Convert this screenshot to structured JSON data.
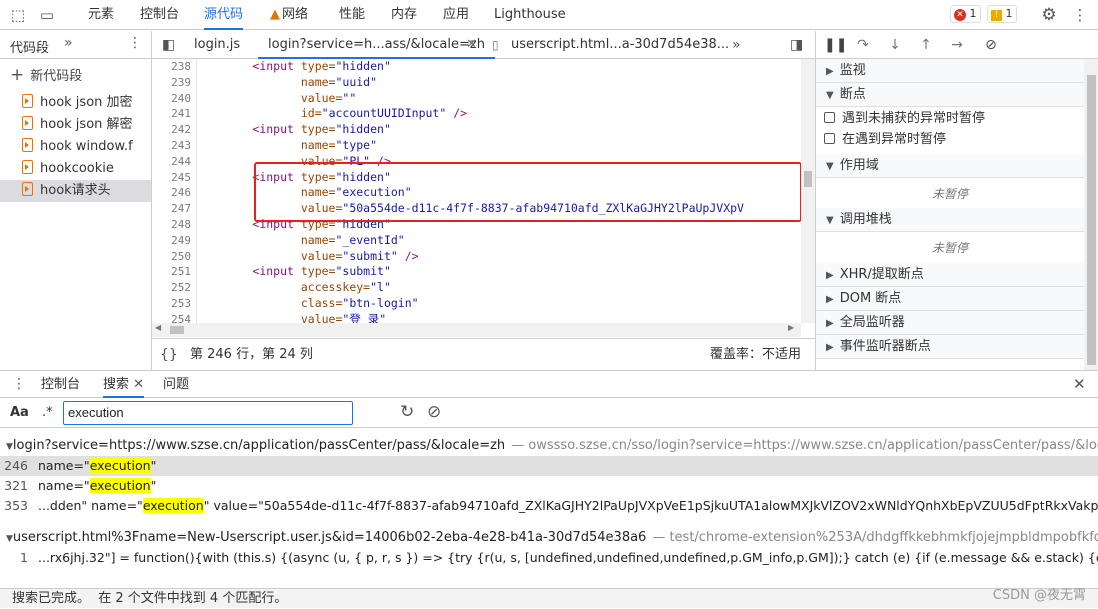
{
  "topbar": {
    "tabs": [
      "元素",
      "控制台",
      "源代码",
      "网络",
      "性能",
      "内存",
      "应用",
      "Lighthouse"
    ],
    "active_tab": "源代码",
    "errors": "1",
    "warnings": "1"
  },
  "left": {
    "header": "代码段",
    "more": "»",
    "new_snippet": "新代码段",
    "snippets": [
      "hook json 加密",
      "hook json 解密",
      "hook window.f",
      "hookcookie",
      "hook请求头"
    ]
  },
  "editor": {
    "tabs": [
      "login.js",
      "login?service=h...ass/&locale=zh",
      "userscript.html...a-30d7d54e38..."
    ],
    "more": "»",
    "line_numbers": [
      "238",
      "239",
      "240",
      "241",
      "242",
      "243",
      "244",
      "245",
      "246",
      "247",
      "248",
      "249",
      "250",
      "251",
      "252",
      "253",
      "254"
    ],
    "status_pos": "第 246 行，第 24 列",
    "coverage": "覆盖率：不适用"
  },
  "debugger": {
    "watch": "监视",
    "breakpoints": "断点",
    "pause_uncaught": "遇到未捕获的异常时暂停",
    "pause_caught": "在遇到异常时暂停",
    "scope": "作用域",
    "not_paused": "未暂停",
    "callstack": "调用堆栈",
    "xhr": "XHR/提取断点",
    "dom": "DOM 断点",
    "global": "全局监听器",
    "event": "事件监听器断点"
  },
  "drawer": {
    "tabs": [
      "控制台",
      "搜索",
      "问题"
    ],
    "active": "搜索",
    "case_label": "Aa",
    "regex_label": ".*",
    "query": "execution"
  },
  "results": {
    "file1": {
      "name": "login?service=https://www.szse.cn/application/passCenter/pass/&locale=zh",
      "path": "— owssso.szse.cn/sso/login?service=https://www.szse.cn/application/passCenter/pass/&locale=zh"
    },
    "lines1": [
      {
        "num": "246",
        "pre": "name=\"",
        "hit": "execution",
        "post": "\""
      },
      {
        "num": "321",
        "pre": "name=\"",
        "hit": "execution",
        "post": "\""
      },
      {
        "num": "353",
        "pre": "...dden\" name=\"",
        "hit": "execution",
        "post": "\" value=\"50a554de-d11c-4f7f-8837-afab94710afd_ZXlKaGJHY2lPaUpJVXpVeE1pSjkuUTA1alowMXJkVlZOV2xWNldYQnhXbEpVZUU5dFptRkxVakpwV2pZe..."
      }
    ],
    "file2": {
      "name": "userscript.html%3Fname=New-Userscript.user.js&id=14006b02-2eba-4e28-b41a-30d7d54e38a6",
      "path": "— test/chrome-extension%253A/dhdgffkkebhmkfjojejmpbldmpobfkfo/userscript.html..."
    },
    "lines2": [
      {
        "num": "1",
        "pre": "...rx6jhj.32\"] = function(){with (this.s) {(async (u, { p, r, s }) => {try {r(u, s, [undefined,undefined,undefined,p.GM_info,p.GM]);} catch (e) {if (e.message && e.stack) {console.error(\"ERROR: ",
        "hit": "Ex",
        "post": ""
      }
    ]
  },
  "status": "搜索已完成。  在 2 个文件中找到 4 个匹配行。",
  "watermark": "CSDN @夜无霄"
}
